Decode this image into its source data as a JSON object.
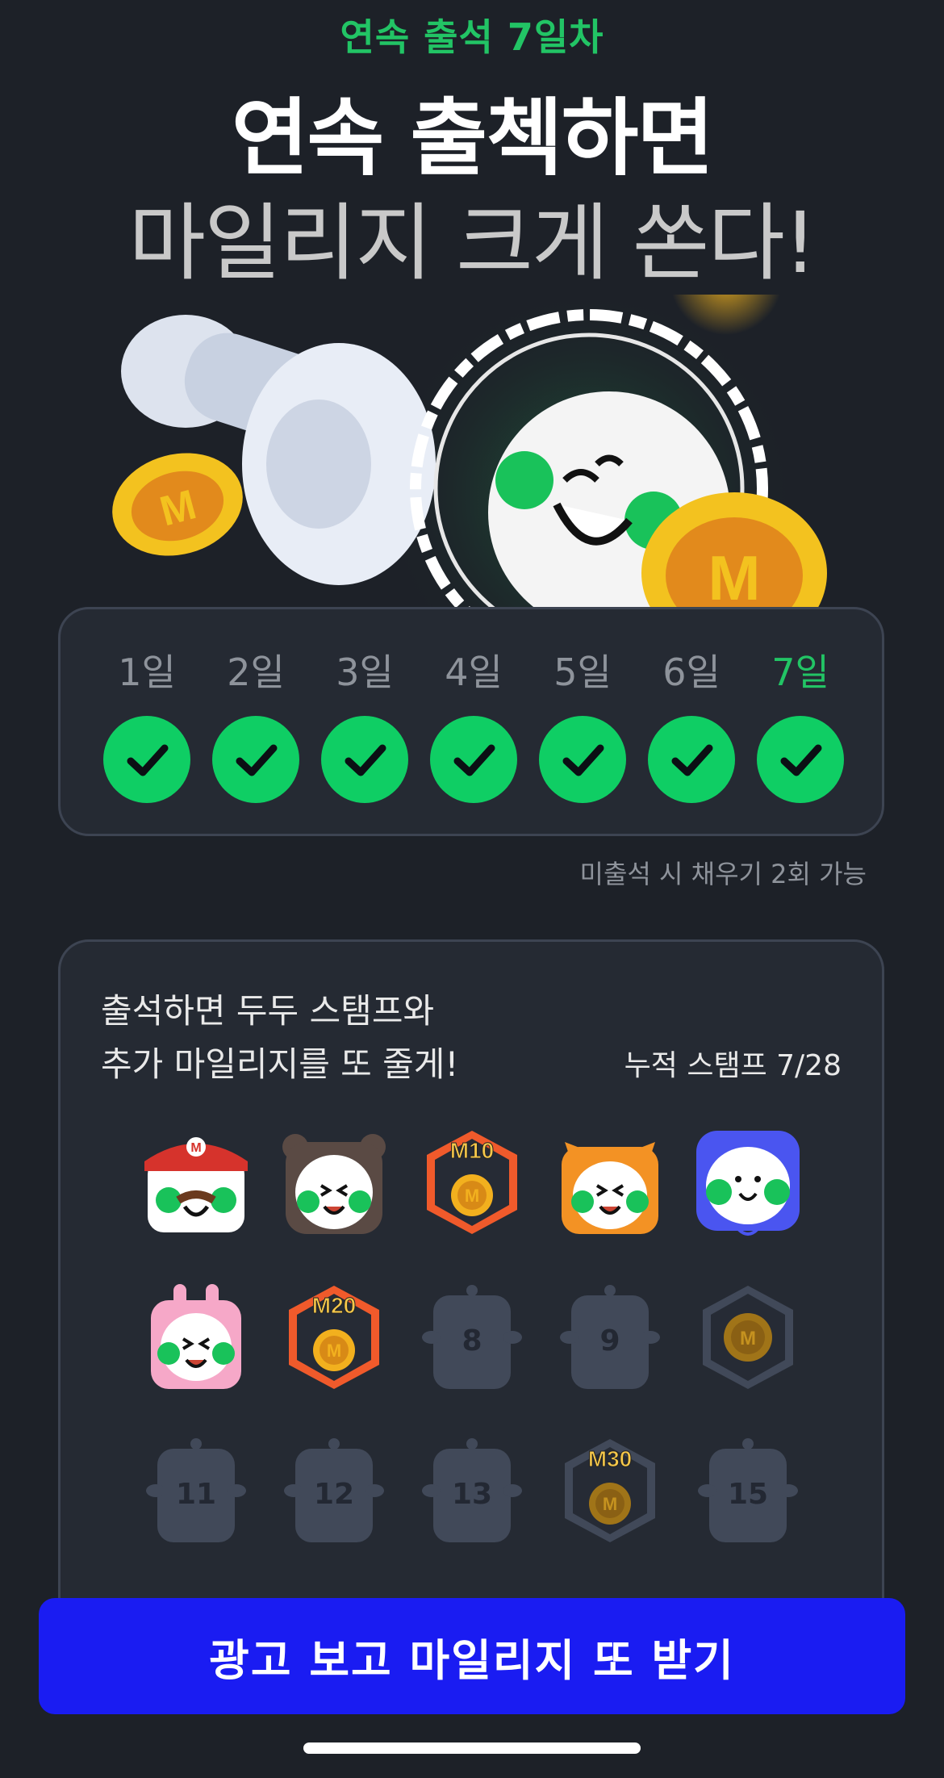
{
  "header": {
    "streak_subtitle": "연속 출석 7일차",
    "headline_line1": "연속 출첵하면",
    "headline_line2": "마일리지 크게 쏜다!"
  },
  "hero": {
    "illustration": "stamp-and-dudu-character-with-mileage-coins"
  },
  "streak": {
    "days": [
      {
        "label": "1일",
        "checked": true
      },
      {
        "label": "2일",
        "checked": true
      },
      {
        "label": "3일",
        "checked": true
      },
      {
        "label": "4일",
        "checked": true
      },
      {
        "label": "5일",
        "checked": true
      },
      {
        "label": "6일",
        "checked": true
      },
      {
        "label": "7일",
        "checked": true,
        "current": true
      }
    ],
    "fill_note": "미출석 시 채우기 2회 가능"
  },
  "stamps": {
    "title_line1": "출석하면 두두 스탬프와",
    "title_line2": "추가 마일리지를 또 줄게!",
    "count_label": "누적 스탬프 7/28",
    "items": [
      {
        "type": "character",
        "icon": "dudu-mario-stamp"
      },
      {
        "type": "character",
        "icon": "dudu-bear-stamp"
      },
      {
        "type": "reward",
        "label": "M10",
        "coin": "M",
        "earned": true
      },
      {
        "type": "character",
        "icon": "dudu-tiger-stamp"
      },
      {
        "type": "character",
        "icon": "dudu-ghost-stamp"
      },
      {
        "type": "character",
        "icon": "dudu-rabbit-stamp"
      },
      {
        "type": "reward",
        "label": "M20",
        "coin": "M",
        "earned": true
      },
      {
        "type": "locked",
        "number": "8"
      },
      {
        "type": "locked",
        "number": "9"
      },
      {
        "type": "reward",
        "label": "",
        "coin": "M",
        "earned": false
      },
      {
        "type": "locked",
        "number": "11"
      },
      {
        "type": "locked",
        "number": "12"
      },
      {
        "type": "locked",
        "number": "13"
      },
      {
        "type": "reward",
        "label": "M30",
        "coin": "M",
        "earned": false
      },
      {
        "type": "locked",
        "number": "15"
      }
    ]
  },
  "cta": {
    "label": "광고 보고 마일리지 또 받기"
  },
  "colors": {
    "background": "#1d2128",
    "accent_green": "#0fce64",
    "cta_blue": "#1a1cf2",
    "coin_gold": "#f2b01e"
  }
}
